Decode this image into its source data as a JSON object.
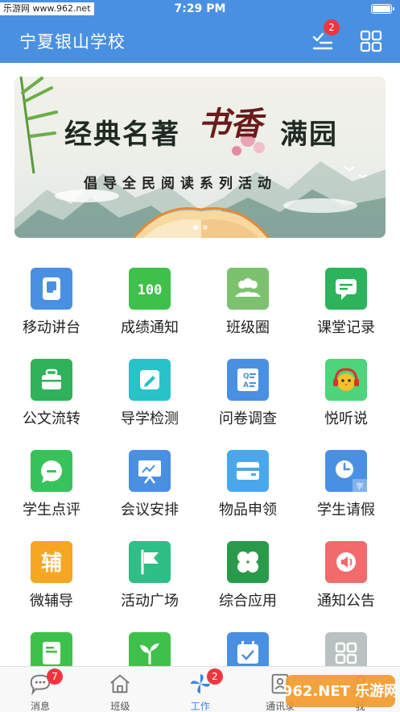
{
  "status_bar": {
    "time": "7:29 PM",
    "watermark": "乐游网 www.962.net"
  },
  "navbar": {
    "title": "宁夏银山学校",
    "todo_badge": "2"
  },
  "banner": {
    "headline_left": "经典名著",
    "headline_calligraphy": "书香",
    "headline_right": "满园",
    "subline": "倡导全民阅读系列活动"
  },
  "grid": [
    {
      "label": "移动讲台",
      "icon": "lectern-icon",
      "color": "#4a90e2"
    },
    {
      "label": "成绩通知",
      "icon": "score-100-icon",
      "color": "#3ec14a"
    },
    {
      "label": "班级圈",
      "icon": "group-icon",
      "color": "#7cc26e"
    },
    {
      "label": "课堂记录",
      "icon": "classroom-chat-icon",
      "color": "#2db35b"
    },
    {
      "label": "公文流转",
      "icon": "briefcase-icon",
      "color": "#2fb25a"
    },
    {
      "label": "导学检测",
      "icon": "edit-check-icon",
      "color": "#28c3c7"
    },
    {
      "label": "问卷调查",
      "icon": "questionnaire-icon",
      "color": "#4a90e2"
    },
    {
      "label": "悦听说",
      "icon": "headphone-chick-icon",
      "color": "#4ed47a"
    },
    {
      "label": "学生点评",
      "icon": "comment-icon",
      "color": "#38c25a"
    },
    {
      "label": "会议安排",
      "icon": "meeting-board-icon",
      "color": "#4a90e2"
    },
    {
      "label": "物品申领",
      "icon": "wallet-icon",
      "color": "#4aa8ea"
    },
    {
      "label": "学生请假",
      "icon": "leave-clock-icon",
      "color": "#4a90e2"
    },
    {
      "label": "微辅导",
      "icon": "tutor-icon",
      "color": "#f5a623"
    },
    {
      "label": "活动广场",
      "icon": "flag-icon",
      "color": "#2ebf86"
    },
    {
      "label": "综合应用",
      "icon": "clover-icon",
      "color": "#2a9a4a"
    },
    {
      "label": "通知公告",
      "icon": "speaker-icon",
      "color": "#f26b6b"
    },
    {
      "label": "",
      "icon": "document-icon",
      "color": "#3ec14a"
    },
    {
      "label": "",
      "icon": "sprout-icon",
      "color": "#3ec14a"
    },
    {
      "label": "",
      "icon": "calendar-check-icon",
      "color": "#4a90e2"
    },
    {
      "label": "",
      "icon": "more-apps-icon",
      "color": "#b9c2c0"
    }
  ],
  "tabbar": [
    {
      "label": "消息",
      "icon": "message-icon",
      "badge": "7"
    },
    {
      "label": "班级",
      "icon": "home-icon",
      "badge": ""
    },
    {
      "label": "工作",
      "icon": "pinwheel-icon",
      "badge": "2"
    },
    {
      "label": "通讯录",
      "icon": "contacts-icon",
      "badge": ""
    },
    {
      "label": "我",
      "icon": "profile-icon",
      "badge": ""
    }
  ],
  "corner_watermark": "962.NET 乐游网"
}
